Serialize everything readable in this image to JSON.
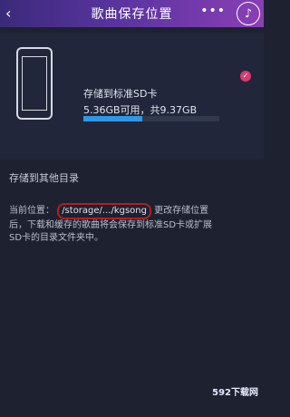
{
  "header": {
    "title": "歌曲保存位置",
    "back_icon": "back-arrow-icon",
    "more_label": "•••",
    "music_icon": "music-icon"
  },
  "storage": {
    "title": "存储到标准SD卡",
    "usage": "5.36GB可用，共9.37GB",
    "used_fraction": 0.43,
    "selected_badge": "selected-check-icon"
  },
  "other": {
    "title": "存储到其他目录",
    "line1_prefix": "当前位置：",
    "path": "/storage/.../kgsong",
    "line1_suffix": "更改存储位置",
    "line2": "后，下载和缓存的歌曲将会保存到标准SD卡或扩展",
    "line3": "SD卡的目录文件夹中。"
  },
  "watermark": {
    "label": "592下载网"
  }
}
